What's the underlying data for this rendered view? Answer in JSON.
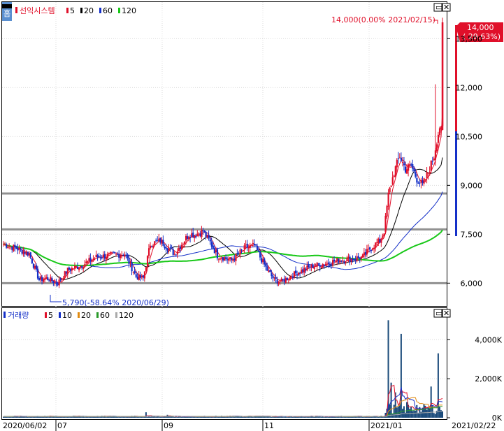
{
  "price_panel": {
    "title": "선익시스템",
    "ma_legend": [
      {
        "label": "5",
        "color": "#e0102a"
      },
      {
        "label": "20",
        "color": "#000000"
      },
      {
        "label": "60",
        "color": "#1530c8"
      },
      {
        "label": "120",
        "color": "#18c818"
      }
    ],
    "y_ticks": [
      "13,500",
      "12,000",
      "10,500",
      "9,000",
      "7,500",
      "6,000"
    ],
    "high_annotation": "14,000(0.00% 2021/02/15)",
    "low_annotation": "5,790(-58.64% 2020/06/29)",
    "current_price": "14,000",
    "current_change": "( 29.63%)",
    "icon": "home-icon"
  },
  "volume_panel": {
    "title": "거래량",
    "ma_legend": [
      {
        "label": "5",
        "color": "#e0102a"
      },
      {
        "label": "10",
        "color": "#1530c8"
      },
      {
        "label": "20",
        "color": "#e08a10"
      },
      {
        "label": "60",
        "color": "#2a9a2a"
      },
      {
        "label": "120",
        "color": "#aaaaaa"
      }
    ],
    "y_ticks": [
      "4,000K",
      "2,000K",
      "0K"
    ]
  },
  "x_axis": {
    "labels": [
      "2020/06/02",
      "07",
      "09",
      "11",
      "2021/01",
      "2021/02/22"
    ]
  },
  "colors": {
    "up": "#e0102a",
    "down": "#1530c8",
    "ref_line": "#909090"
  },
  "chart_data": {
    "type": "candlestick",
    "price_range": [
      5300,
      14600
    ],
    "volume_range": [
      0,
      5300
    ],
    "horizontal_reference_lines": [
      8750,
      7650,
      6000
    ],
    "ohlc_anchor_closes": [
      [
        0,
        7200
      ],
      [
        10,
        7050
      ],
      [
        18,
        6900
      ],
      [
        25,
        6100
      ],
      [
        30,
        6150
      ],
      [
        38,
        6000
      ],
      [
        45,
        6400
      ],
      [
        55,
        6550
      ],
      [
        65,
        6800
      ],
      [
        75,
        6850
      ],
      [
        85,
        6900
      ],
      [
        93,
        6200
      ],
      [
        98,
        6150
      ],
      [
        103,
        7200
      ],
      [
        110,
        7300
      ],
      [
        120,
        6900
      ],
      [
        130,
        7500
      ],
      [
        135,
        7500
      ],
      [
        140,
        7600
      ],
      [
        145,
        7250
      ],
      [
        150,
        6850
      ],
      [
        160,
        6700
      ],
      [
        170,
        7100
      ],
      [
        176,
        7150
      ],
      [
        180,
        6800
      ],
      [
        185,
        6400
      ],
      [
        190,
        6100
      ],
      [
        195,
        6050
      ],
      [
        205,
        6300
      ],
      [
        215,
        6500
      ],
      [
        225,
        6600
      ],
      [
        235,
        6700
      ],
      [
        245,
        6750
      ],
      [
        252,
        6800
      ],
      [
        258,
        7100
      ],
      [
        264,
        7300
      ],
      [
        267,
        7600
      ],
      [
        270,
        8700
      ],
      [
        274,
        9400
      ],
      [
        278,
        9900
      ],
      [
        282,
        9500
      ],
      [
        286,
        9600
      ],
      [
        290,
        9200
      ],
      [
        294,
        9000
      ],
      [
        298,
        9400
      ],
      [
        302,
        9900
      ],
      [
        304,
        10400
      ],
      [
        306,
        10800
      ],
      [
        307,
        14000
      ]
    ],
    "volume_series": {
      "unit": "K",
      "spikes": [
        [
          100,
          280
        ],
        [
          115,
          150
        ],
        [
          270,
          5000
        ],
        [
          272,
          1800
        ],
        [
          275,
          1300
        ],
        [
          279,
          4300
        ],
        [
          283,
          800
        ],
        [
          290,
          650
        ],
        [
          300,
          1600
        ],
        [
          305,
          3300
        ]
      ],
      "base": 70
    },
    "moving_averages": {
      "price": [
        5,
        20,
        60,
        120
      ],
      "volume": [
        5,
        10,
        20,
        60,
        120
      ]
    }
  }
}
